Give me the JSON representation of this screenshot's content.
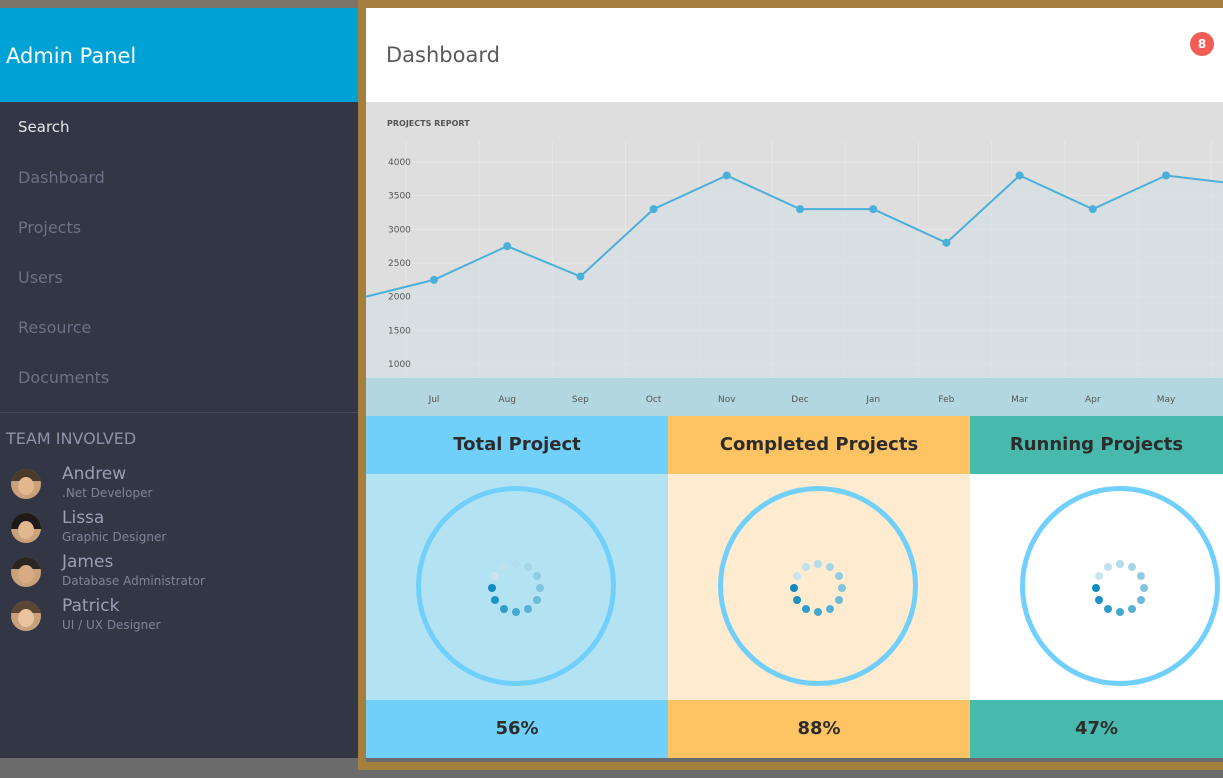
{
  "sidebar": {
    "brand": "Admin Panel",
    "search_label": "Search",
    "nav": [
      {
        "label": "Dashboard"
      },
      {
        "label": "Projects"
      },
      {
        "label": "Users"
      },
      {
        "label": "Resource"
      },
      {
        "label": "Documents"
      }
    ],
    "team_title": "TEAM INVOLVED",
    "team": [
      {
        "name": "Andrew",
        "role": ".Net Developer"
      },
      {
        "name": "Lissa",
        "role": "Graphic Designer"
      },
      {
        "name": "James",
        "role": "Database Administrator"
      },
      {
        "name": "Patrick",
        "role": "UI / UX Designer"
      }
    ]
  },
  "header": {
    "title": "Dashboard",
    "notification_count": "8"
  },
  "chart_data": {
    "type": "line",
    "title": "PROJECTS REPORT",
    "categories": [
      "Jul",
      "Aug",
      "Sep",
      "Oct",
      "Nov",
      "Dec",
      "Jan",
      "Feb",
      "Mar",
      "Apr",
      "May"
    ],
    "values": [
      2250,
      2750,
      2300,
      3300,
      3800,
      3300,
      3300,
      2800,
      3800,
      3300,
      3800
    ],
    "ylim": [
      1000,
      4000
    ],
    "yticks": [
      "4000",
      "3500",
      "3000",
      "2500",
      "2000",
      "1500",
      "1000"
    ],
    "grid": true,
    "colors": {
      "line": "#4ab0d9",
      "fill": "#d5e0e6",
      "axisband": "#b2d7e0"
    }
  },
  "cards": [
    {
      "title": "Total Project",
      "value": "56%",
      "colors": {
        "head": "#71d0fa",
        "body": "#b3e2f2",
        "foot": "#71d0fa"
      }
    },
    {
      "title": "Completed Projects",
      "value": "88%",
      "colors": {
        "head": "#fec362",
        "body": "#feebd0",
        "foot": "#fec362"
      }
    },
    {
      "title": "Running Projects",
      "value": "47%",
      "colors": {
        "head": "#47b9ad",
        "body": "#ffffff",
        "foot": "#47b9ad"
      }
    }
  ]
}
